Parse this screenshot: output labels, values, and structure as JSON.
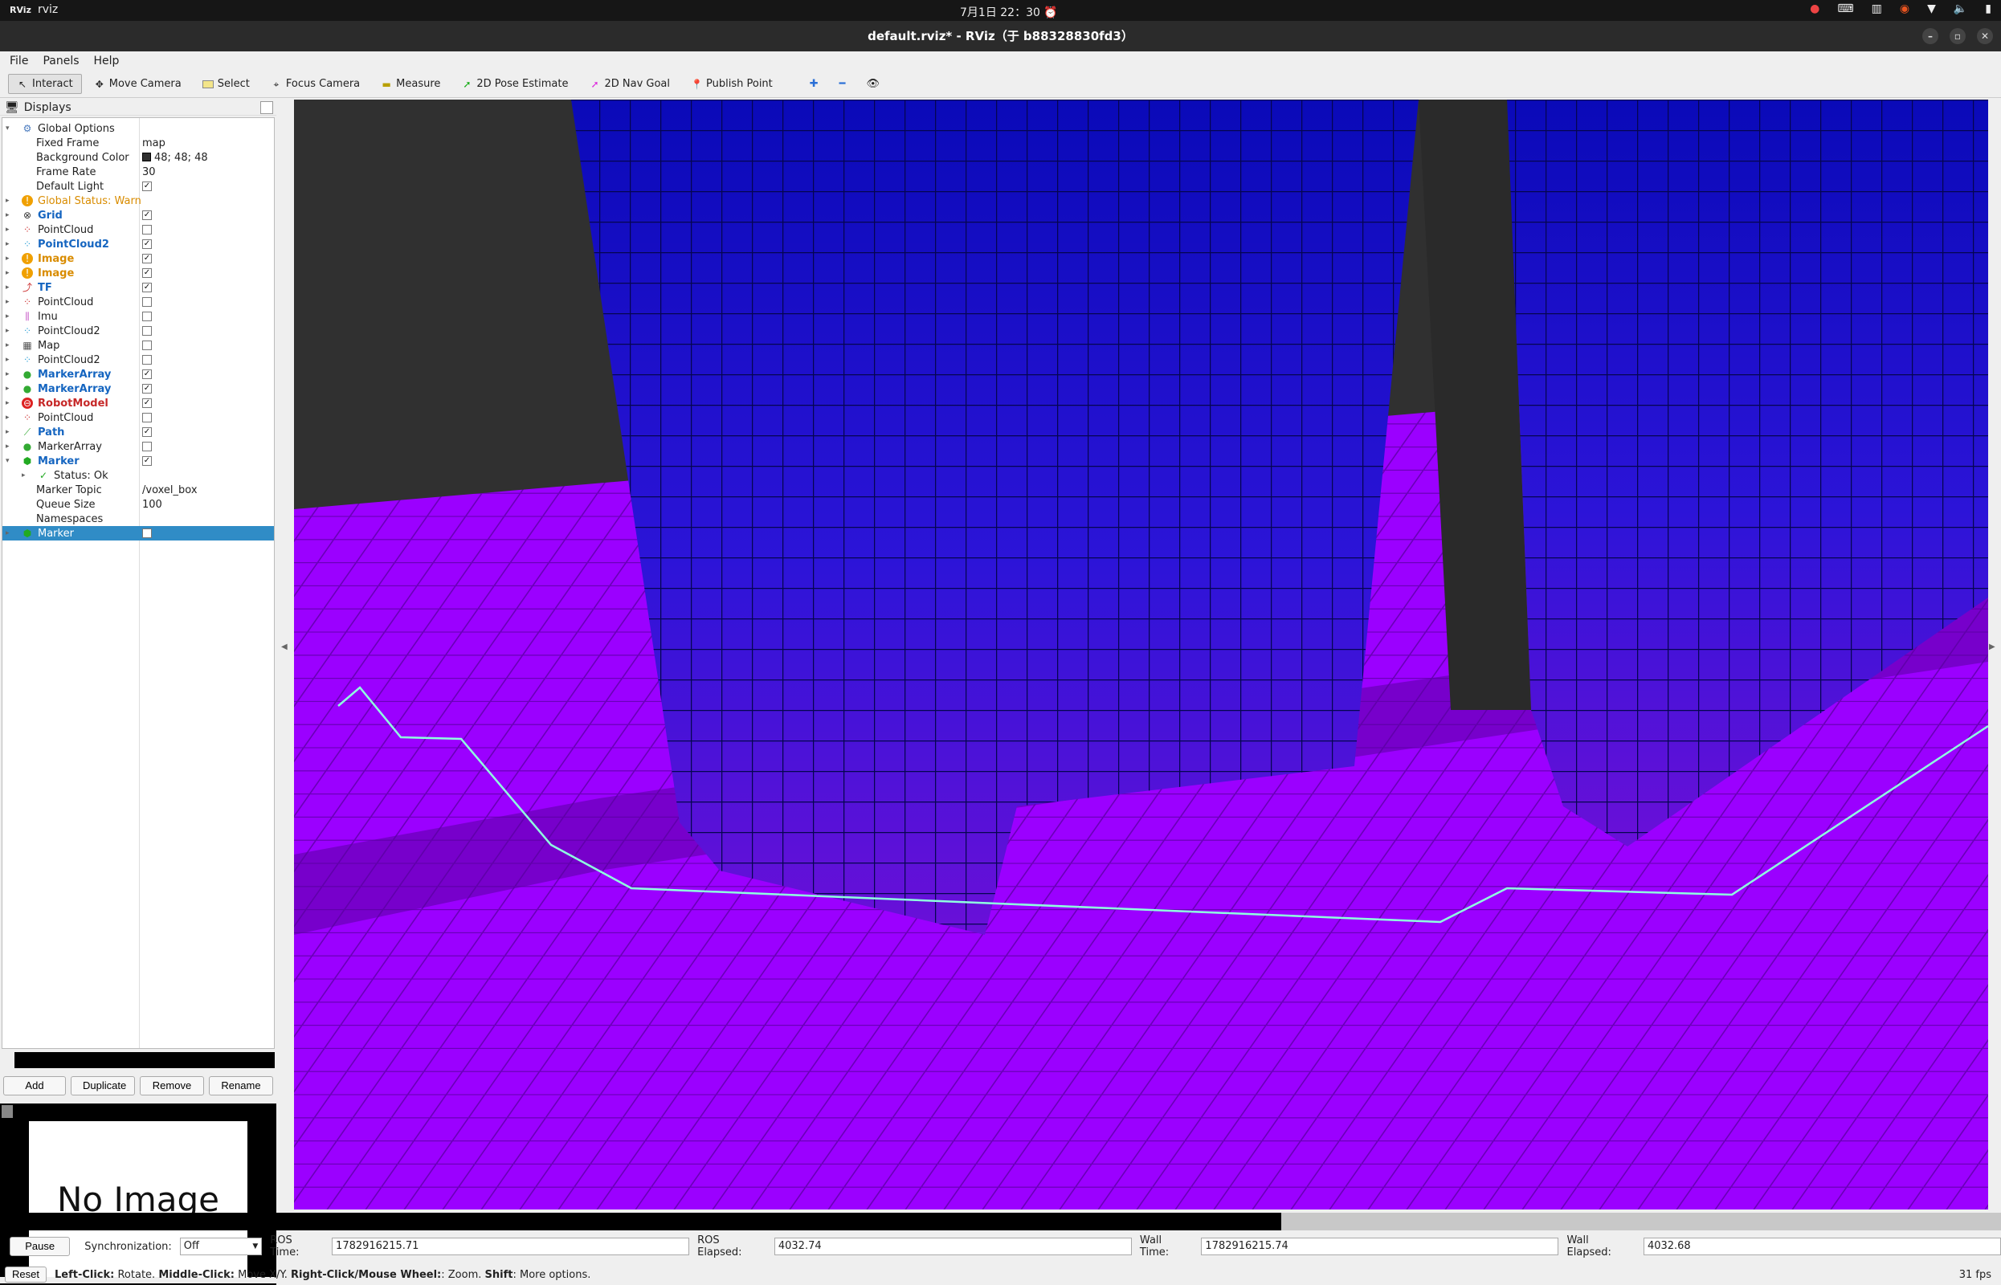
{
  "system": {
    "app_name": "rviz",
    "clock": "7月1日 22：30"
  },
  "window": {
    "title": "default.rviz* - RViz（于 b88328830fd3）"
  },
  "menu": [
    "File",
    "Panels",
    "Help"
  ],
  "toolbar": {
    "interact": "Interact",
    "move_camera": "Move Camera",
    "select": "Select",
    "focus_camera": "Focus Camera",
    "measure": "Measure",
    "pose_estimate": "2D Pose Estimate",
    "nav_goal": "2D Nav Goal",
    "publish_point": "Publish Point"
  },
  "displays": {
    "title": "Displays",
    "rows": [
      {
        "label": "Global Options",
        "expanded": true
      },
      {
        "label": "Fixed Frame",
        "value": "map"
      },
      {
        "label": "Background Color",
        "value": "48; 48; 48",
        "swatch": "#303030"
      },
      {
        "label": "Frame Rate",
        "value": "30"
      },
      {
        "label": "Default Light",
        "checked": true
      },
      {
        "label": "Global Status: Warn",
        "status": "warn"
      },
      {
        "label": "Grid",
        "checked": true
      },
      {
        "label": "PointCloud",
        "checked": false
      },
      {
        "label": "PointCloud2",
        "checked": true
      },
      {
        "label": "Image",
        "checked": true
      },
      {
        "label": "Image",
        "checked": true
      },
      {
        "label": "TF",
        "checked": true
      },
      {
        "label": "PointCloud",
        "checked": false
      },
      {
        "label": "Imu",
        "checked": false
      },
      {
        "label": "PointCloud2",
        "checked": false
      },
      {
        "label": "Map",
        "checked": false
      },
      {
        "label": "PointCloud2",
        "checked": false
      },
      {
        "label": "MarkerArray",
        "checked": true
      },
      {
        "label": "MarkerArray",
        "checked": true
      },
      {
        "label": "RobotModel",
        "checked": true
      },
      {
        "label": "PointCloud",
        "checked": false
      },
      {
        "label": "Path",
        "checked": true
      },
      {
        "label": "MarkerArray",
        "checked": false
      },
      {
        "label": "Marker",
        "checked": true,
        "expanded": true
      },
      {
        "label": "Status: Ok"
      },
      {
        "label": "Marker Topic",
        "value": "/voxel_box"
      },
      {
        "label": "Queue Size",
        "value": "100"
      },
      {
        "label": "Namespaces"
      },
      {
        "label": "Marker",
        "checked": false,
        "selected": true
      }
    ]
  },
  "buttons": {
    "add": "Add",
    "duplicate": "Duplicate",
    "remove": "Remove",
    "rename": "Rename"
  },
  "image_panel": {
    "placeholder": "No Image"
  },
  "time": {
    "pause": "Pause",
    "sync_label": "Synchronization:",
    "sync_value": "Off",
    "ros_time_label": "ROS Time:",
    "ros_time": "1782916215.71",
    "ros_elapsed_label": "ROS Elapsed:",
    "ros_elapsed": "4032.74",
    "wall_time_label": "Wall Time:",
    "wall_time": "1782916215.74",
    "wall_elapsed_label": "Wall Elapsed:",
    "wall_elapsed": "4032.68"
  },
  "status": {
    "reset": "Reset",
    "hint_prefix": "Left-Click:",
    "hint1": " Rotate. ",
    "m_label": "Middle-Click:",
    "hint2": " Move X/Y. ",
    "r_label": "Right-Click/Mouse Wheel:",
    "hint3": ": Zoom. ",
    "s_label": "Shift",
    "hint4": ": More options.",
    "fps": "31 fps"
  },
  "colors": {
    "floor": "#9a00ff",
    "wall_top": "#1010c0",
    "wall_bottom": "#5a10d0",
    "path": "#7fffd4",
    "background": "#303030"
  }
}
